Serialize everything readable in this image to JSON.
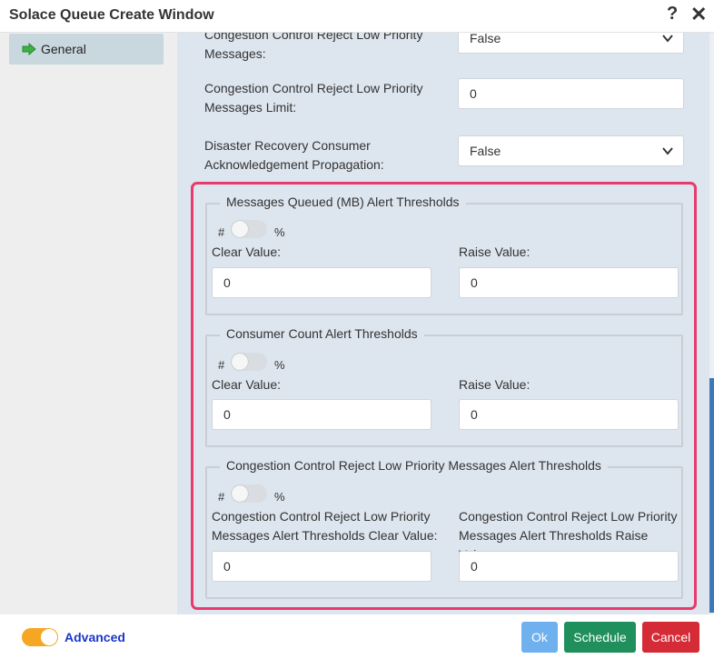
{
  "window": {
    "title": "Solace Queue Create Window",
    "help_glyph": "?",
    "close_glyph": "✕"
  },
  "sidebar": {
    "items": [
      {
        "label": "General",
        "icon": "green-arrow-icon",
        "active": true
      }
    ]
  },
  "form": {
    "cc_reject_low_priority": {
      "label_line1": "Congestion Control Reject Low Priority",
      "label_line2": "Messages:",
      "value": "False"
    },
    "cc_reject_limit": {
      "label_line1": "Congestion Control Reject Low Priority",
      "label_line2": "Messages Limit:",
      "value": "0"
    },
    "dr_consumer_ack": {
      "label_line1": "Disaster Recovery Consumer",
      "label_line2": "Acknowledgement Propagation:",
      "value": "False"
    }
  },
  "thresholds": [
    {
      "legend": "Messages Queued (MB) Alert Thresholds",
      "hash": "#",
      "pct": "%",
      "toggle_on": false,
      "clear_label_line1": "Clear Value:",
      "clear_label_line2": "",
      "raise_label_line1": "Raise Value:",
      "raise_label_line2": "",
      "clear_value": "0",
      "raise_value": "0"
    },
    {
      "legend": "Consumer Count Alert Thresholds",
      "hash": "#",
      "pct": "%",
      "toggle_on": false,
      "clear_label_line1": "Clear Value:",
      "clear_label_line2": "",
      "raise_label_line1": "Raise Value:",
      "raise_label_line2": "",
      "clear_value": "0",
      "raise_value": "0"
    },
    {
      "legend": "Congestion Control Reject Low Priority Messages Alert Thresholds",
      "hash": "#",
      "pct": "%",
      "toggle_on": false,
      "clear_label_line1": "Congestion Control Reject Low Priority",
      "clear_label_line2": "Messages Alert Thresholds Clear Value:",
      "raise_label_line1": "Congestion Control Reject Low Priority",
      "raise_label_line2": "Messages Alert Thresholds Raise Value:",
      "clear_value": "0",
      "raise_value": "0"
    }
  ],
  "footer": {
    "advanced_label": "Advanced",
    "advanced_on": true,
    "ok_label": "Ok",
    "schedule_label": "Schedule",
    "cancel_label": "Cancel"
  },
  "colors": {
    "highlight_border": "#e83a6c",
    "advanced_toggle": "#f5a623",
    "advanced_text": "#1a36c8",
    "ok": "#6fb1ef",
    "schedule": "#1f8f5c",
    "cancel": "#d42b36"
  }
}
